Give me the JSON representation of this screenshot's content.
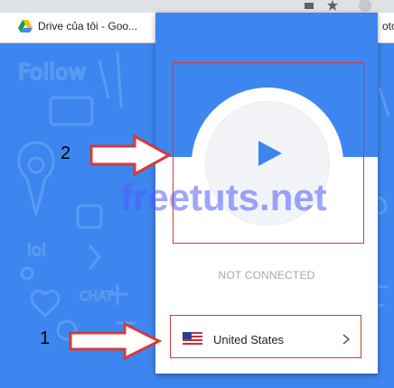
{
  "browser": {
    "bookmarks": [
      {
        "label": "Drive của tôi - Goo..."
      },
      {
        "label": "oto"
      }
    ]
  },
  "popup": {
    "status": "NOT CONNECTED",
    "location": "United States"
  },
  "overlay": {
    "watermark": "freetuts.net",
    "annotation_1": "1",
    "annotation_2": "2",
    "colors": {
      "annotation_red": "#d63a3a",
      "primary_blue": "#3d86ef"
    }
  }
}
